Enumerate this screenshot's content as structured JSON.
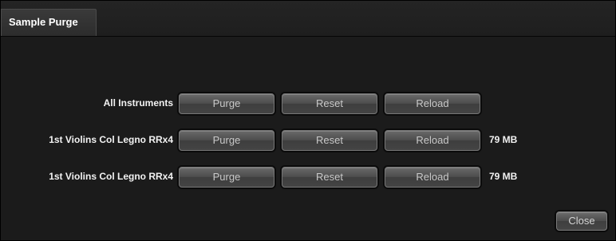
{
  "window": {
    "tab_title": "Sample Purge"
  },
  "rows": [
    {
      "label": "All Instruments",
      "purge_label": "Purge",
      "reset_label": "Reset",
      "reload_label": "Reload",
      "size": ""
    },
    {
      "label": "1st Violins Col Legno RRx4",
      "purge_label": "Purge",
      "reset_label": "Reset",
      "reload_label": "Reload",
      "size": "79 MB"
    },
    {
      "label": "1st Violins Col Legno RRx4",
      "purge_label": "Purge",
      "reset_label": "Reset",
      "reload_label": "Reload",
      "size": "79 MB"
    }
  ],
  "footer": {
    "close_label": "Close"
  },
  "colors": {
    "background": "#1b1b1b",
    "button_face": "#4b4b4b",
    "text": "#f2f2f2"
  }
}
